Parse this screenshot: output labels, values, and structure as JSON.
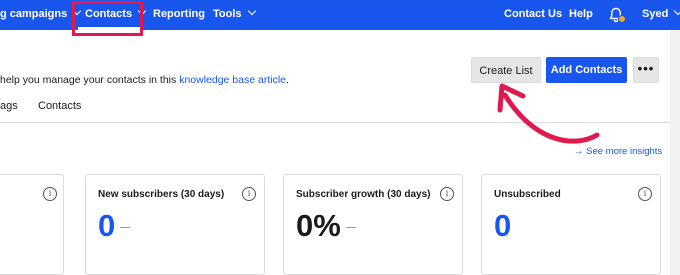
{
  "nav": {
    "items": [
      {
        "label": "g campaigns"
      },
      {
        "label": "Contacts"
      },
      {
        "label": "Reporting"
      },
      {
        "label": "Tools"
      }
    ],
    "right": {
      "contact_us": "Contact Us",
      "help": "Help",
      "user": "Syed"
    }
  },
  "page": {
    "help_prefix": "help you manage your contacts in this ",
    "help_link": "knowledge base article",
    "help_suffix": ".",
    "buttons": {
      "create_list": "Create List",
      "add_contacts": "Add Contacts",
      "more": "•••"
    },
    "tabs": [
      {
        "label": "ags"
      },
      {
        "label": "Contacts"
      }
    ],
    "insights_link": "See more insights",
    "insights_arrow": "→"
  },
  "cards": [
    {
      "title": "",
      "value": ""
    },
    {
      "title": "New subscribers (30 days)",
      "value": "0"
    },
    {
      "title": "Subscriber growth (30 days)",
      "value": "0%"
    },
    {
      "title": "Unsubscribed",
      "value": "0"
    }
  ],
  "info_glyph": "i",
  "colors": {
    "nav_bg": "#1856ed",
    "accent_blue": "#1856ed",
    "highlight_red": "#e01a4f",
    "badge_orange": "#f5a623"
  },
  "icons": {
    "nav_chevron": "chevron-down-icon",
    "notification": "bell-icon",
    "info": "info-icon",
    "insights": "arrow-right-icon",
    "annotation": "curved-arrow-annotation"
  }
}
